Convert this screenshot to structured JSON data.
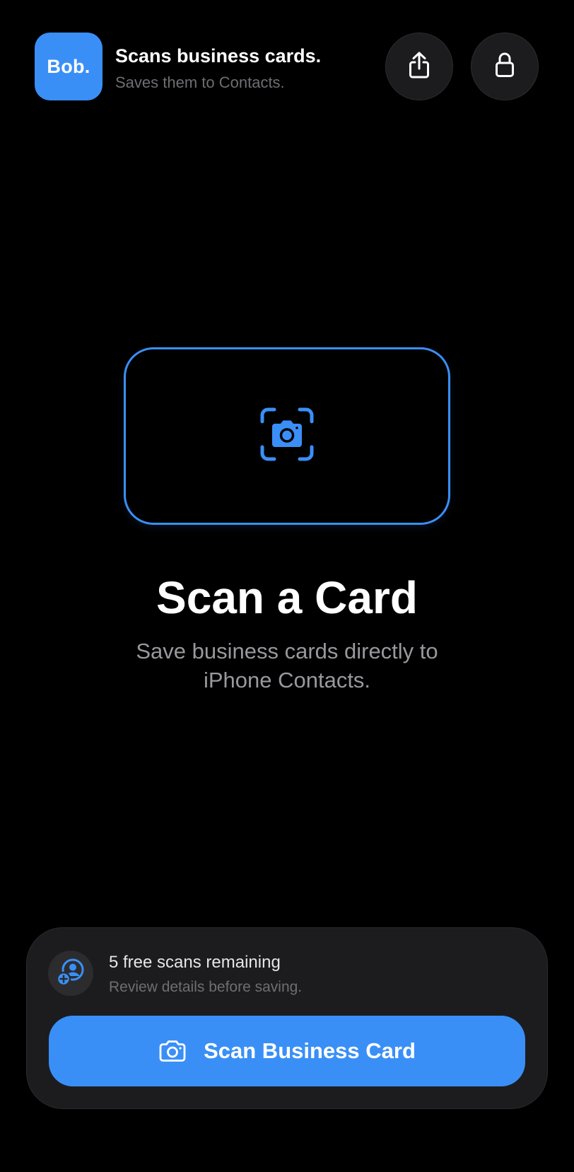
{
  "header": {
    "app_icon_text": "Bob.",
    "title": "Scans business cards.",
    "subtitle": "Saves them to Contacts.",
    "share_icon": "share-icon",
    "lock_icon": "lock-icon"
  },
  "hero": {
    "icon": "camera-viewfinder-icon",
    "title": "Scan a Card",
    "subtitle": "Save business cards directly to iPhone Contacts."
  },
  "footer": {
    "badge_icon": "add-contact-icon",
    "scans_remaining": "5 free scans remaining",
    "note": "Review details before saving.",
    "button_icon": "camera-icon",
    "button_label": "Scan Business Card"
  },
  "colors": {
    "accent": "#3a8ff7",
    "background": "#000000",
    "card": "#1c1c1e",
    "secondary_text": "#98989d",
    "tertiary_text": "#6e6e73"
  }
}
